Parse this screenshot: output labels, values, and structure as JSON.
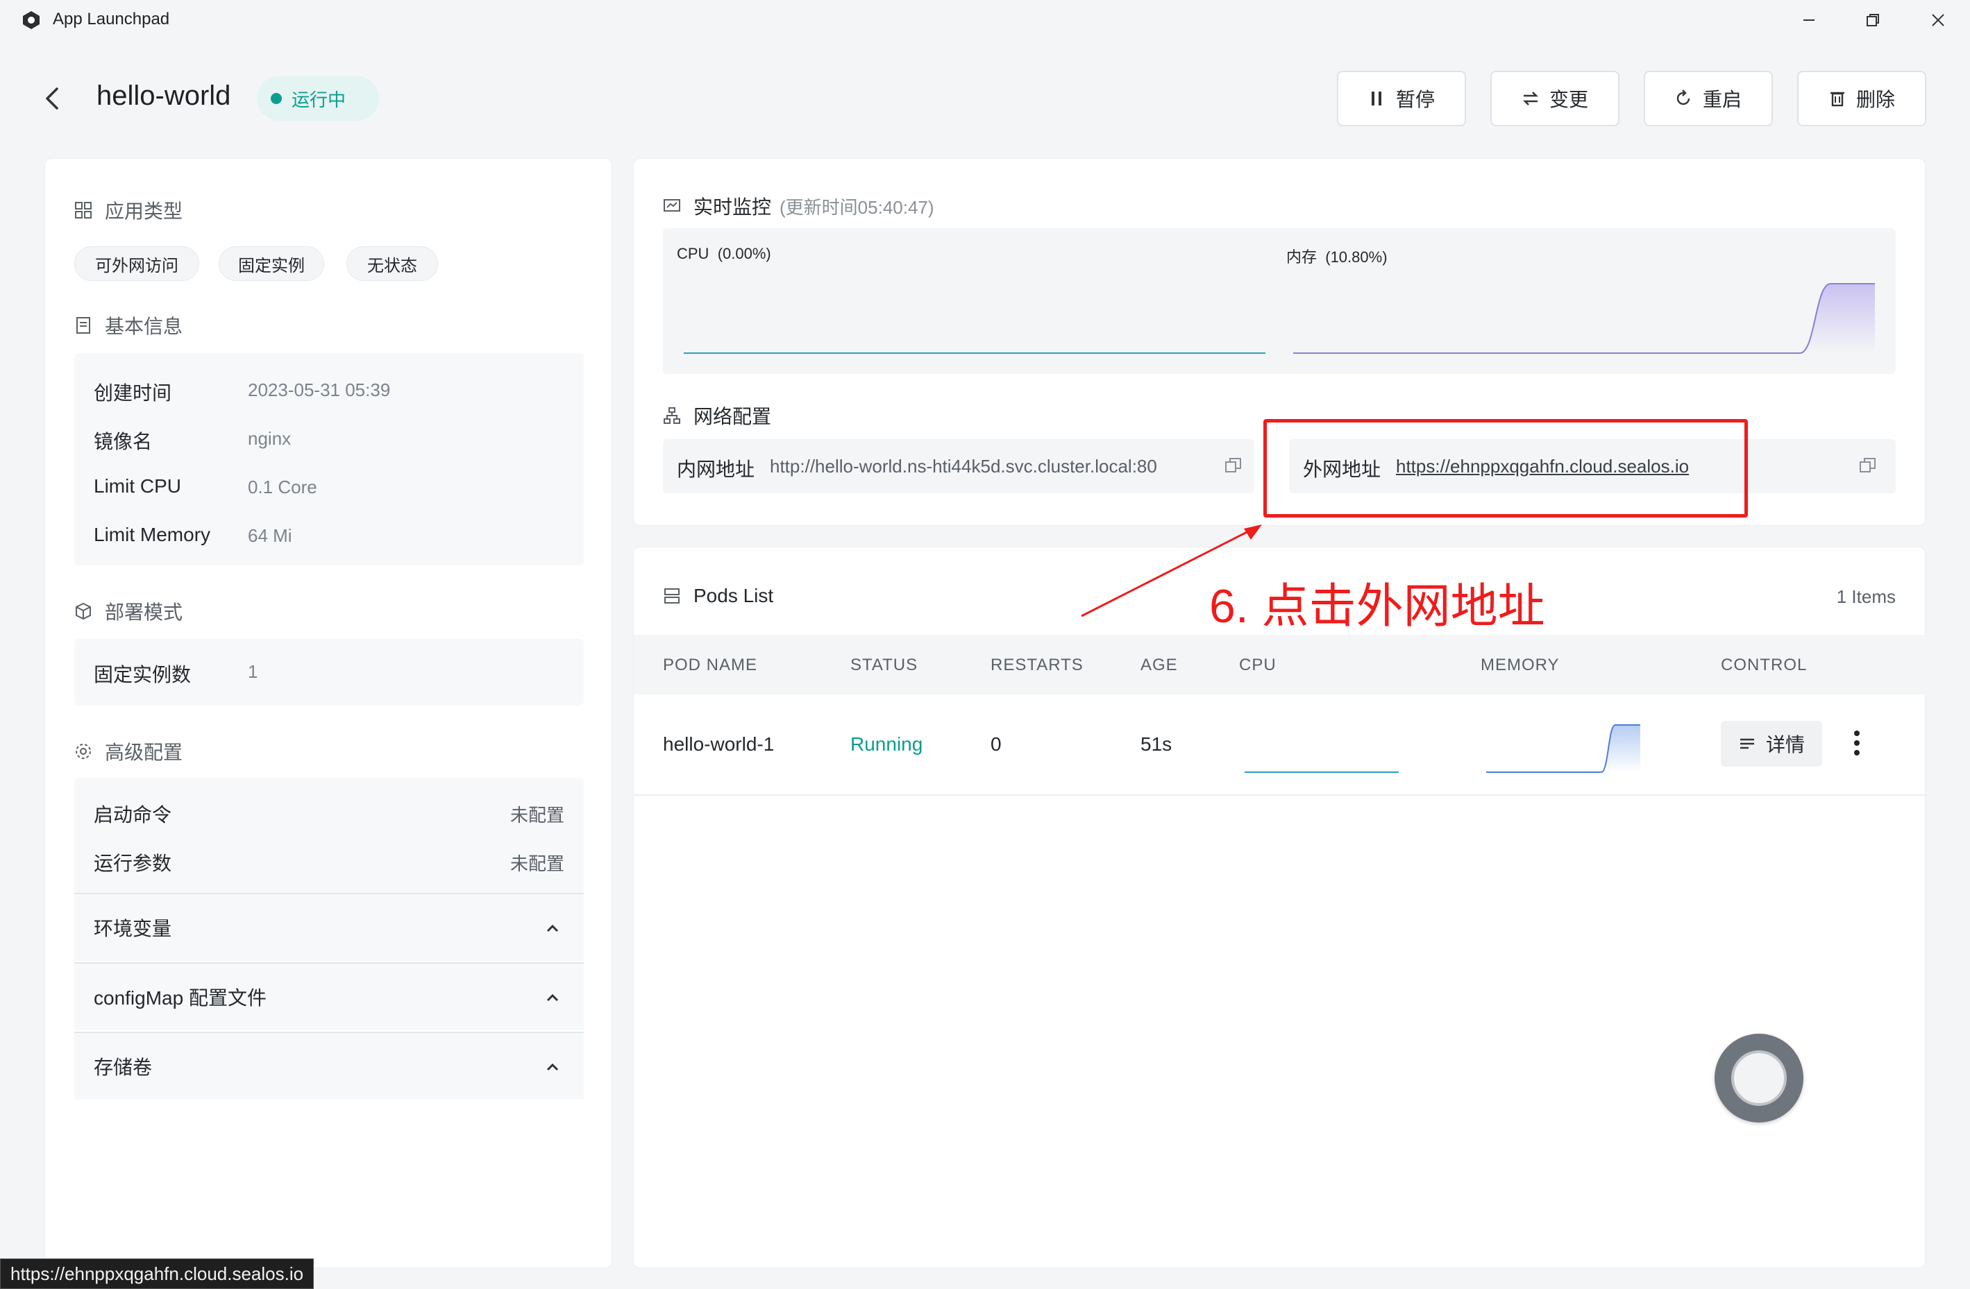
{
  "window": {
    "title": "App Launchpad"
  },
  "header": {
    "app_name": "hello-world",
    "status": "运行中",
    "buttons": {
      "pause": "暂停",
      "change": "变更",
      "restart": "重启",
      "delete": "删除"
    }
  },
  "left": {
    "app_type": {
      "title": "应用类型",
      "tags": [
        "可外网访问",
        "固定实例",
        "无状态"
      ]
    },
    "basic": {
      "title": "基本信息",
      "rows": [
        {
          "label": "创建时间",
          "value": "2023-05-31 05:39"
        },
        {
          "label": "镜像名",
          "value": "nginx"
        },
        {
          "label": "Limit CPU",
          "value": "0.1 Core"
        },
        {
          "label": "Limit Memory",
          "value": "64 Mi"
        }
      ]
    },
    "deploy": {
      "title": "部署模式",
      "label": "固定实例数",
      "value": "1"
    },
    "advanced": {
      "title": "高级配置",
      "rows": [
        {
          "label": "启动命令",
          "value": "未配置"
        },
        {
          "label": "运行参数",
          "value": "未配置"
        }
      ],
      "collapsibles": [
        "环境变量",
        "configMap 配置文件",
        "存储卷"
      ]
    }
  },
  "monitor": {
    "title": "实时监控",
    "updated": "(更新时间05:40:47)",
    "cpu_label": "CPU",
    "cpu_value": "(0.00%)",
    "mem_label": "内存",
    "mem_value": "(10.80%)"
  },
  "network": {
    "title": "网络配置",
    "internal_label": "内网地址",
    "internal_value": "http://hello-world.ns-hti44k5d.svc.cluster.local:80",
    "external_label": "外网地址",
    "external_value": "https://ehnppxqgahfn.cloud.sealos.io"
  },
  "annotation": {
    "text": "6. 点击外网地址",
    "color": "#ef1c1c"
  },
  "pods": {
    "title": "Pods List",
    "count": "1 Items",
    "columns": [
      "POD NAME",
      "STATUS",
      "RESTARTS",
      "AGE",
      "CPU",
      "MEMORY",
      "CONTROL"
    ],
    "rows": [
      {
        "name": "hello-world-1",
        "status": "Running",
        "restarts": "0",
        "age": "51s",
        "detail": "详情"
      }
    ]
  },
  "status_bar": {
    "url": "https://ehnppxqgahfn.cloud.sealos.io"
  },
  "colors": {
    "accent": "#0a9e8e",
    "annotation": "#ef1c1c",
    "mem_line": "#8a7fd6",
    "cpu_line": "#2a9fbf"
  }
}
